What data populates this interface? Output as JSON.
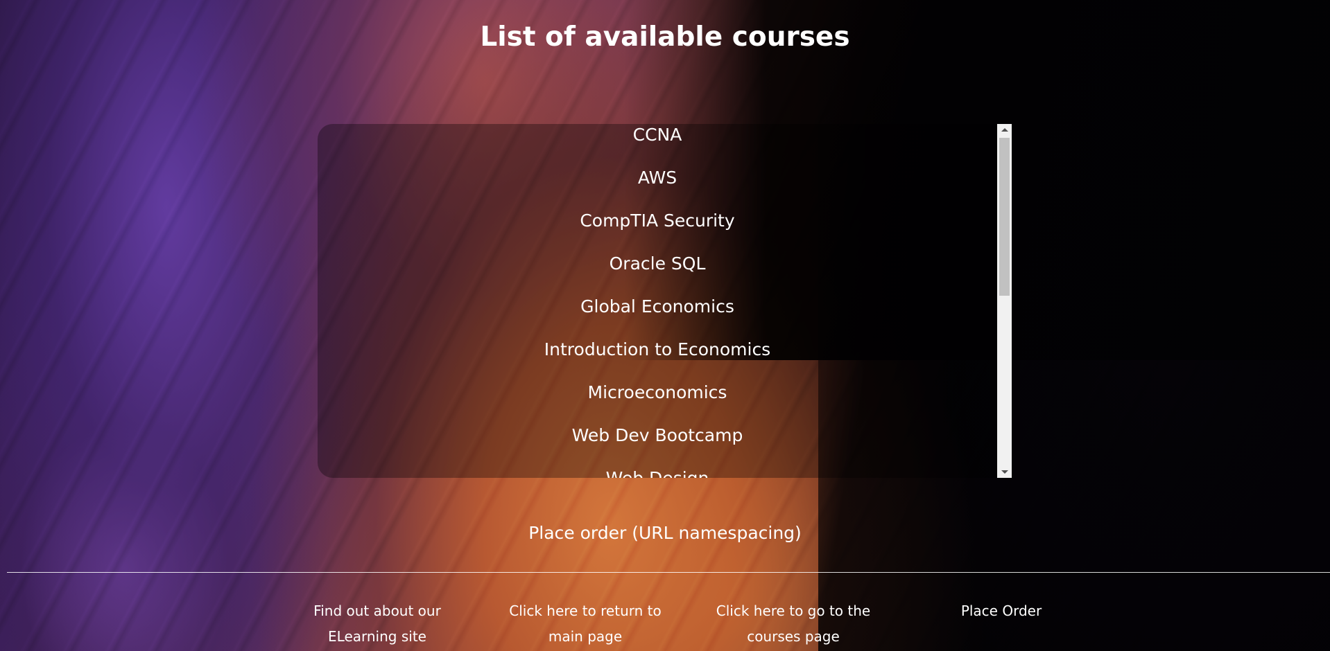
{
  "page": {
    "title": "List of available courses"
  },
  "courses": [
    "CCNA",
    "AWS",
    "CompTIA Security",
    "Oracle SQL",
    "Global Economics",
    "Introduction to Economics",
    "Microeconomics",
    "Web Dev Bootcamp",
    "Web Design"
  ],
  "order_link": {
    "label": "Place order (URL namespacing)"
  },
  "footer": {
    "links": [
      "Find out about our ELearning site",
      "Click here to return to main page",
      "Click here to go to the courses page",
      "Place Order"
    ]
  },
  "colors": {
    "text": "#ffffff",
    "panel": "rgba(0,0,0,0.32)",
    "scrollbar_track": "#f1f1f1",
    "scrollbar_thumb": "#c1c1c1"
  }
}
